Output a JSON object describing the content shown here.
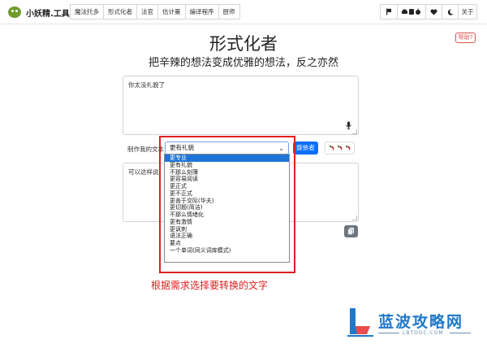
{
  "navbar": {
    "brand": "小妖精.工具",
    "menu": [
      "魔法托多",
      "形式化者",
      "法官",
      "估计量",
      "编译程序",
      "厨师"
    ],
    "right_icons": [
      "flag-icon",
      "car-icon",
      "heart-icon",
      "moon-icon"
    ],
    "about": "关于"
  },
  "header": {
    "help_label": "帮助?",
    "title": "形式化者",
    "subtitle": "把辛辣的想法变成优雅的想法，反之亦然"
  },
  "input": {
    "value": "你太没礼貌了"
  },
  "controls": {
    "make_label": "制作我的文本",
    "selected": "更有礼貌",
    "go_label": "旋依者"
  },
  "output": {
    "value": "可以这样说："
  },
  "dropdown": {
    "options": [
      "更专业",
      "更有礼貌",
      "不那么刻薄",
      "更容易阅读",
      "更正式",
      "更不正式",
      "更善于交际(华夫)",
      "更切题(简洁)",
      "不那么情绪化",
      "更有激情",
      "更讽刺",
      "语法正确",
      "要点",
      "一个单词(同义词库模式)"
    ],
    "highlighted_index": 0
  },
  "annotation": {
    "text": "根据需求选择要转换的文字"
  },
  "watermark": {
    "title": "蓝波攻略网",
    "sub": "LBTDOC.COM"
  },
  "colors": {
    "primary": "#0d6efd",
    "annotation_red": "#e02020",
    "watermark_blue": "#1f78c8",
    "help_red": "#d9534f"
  }
}
